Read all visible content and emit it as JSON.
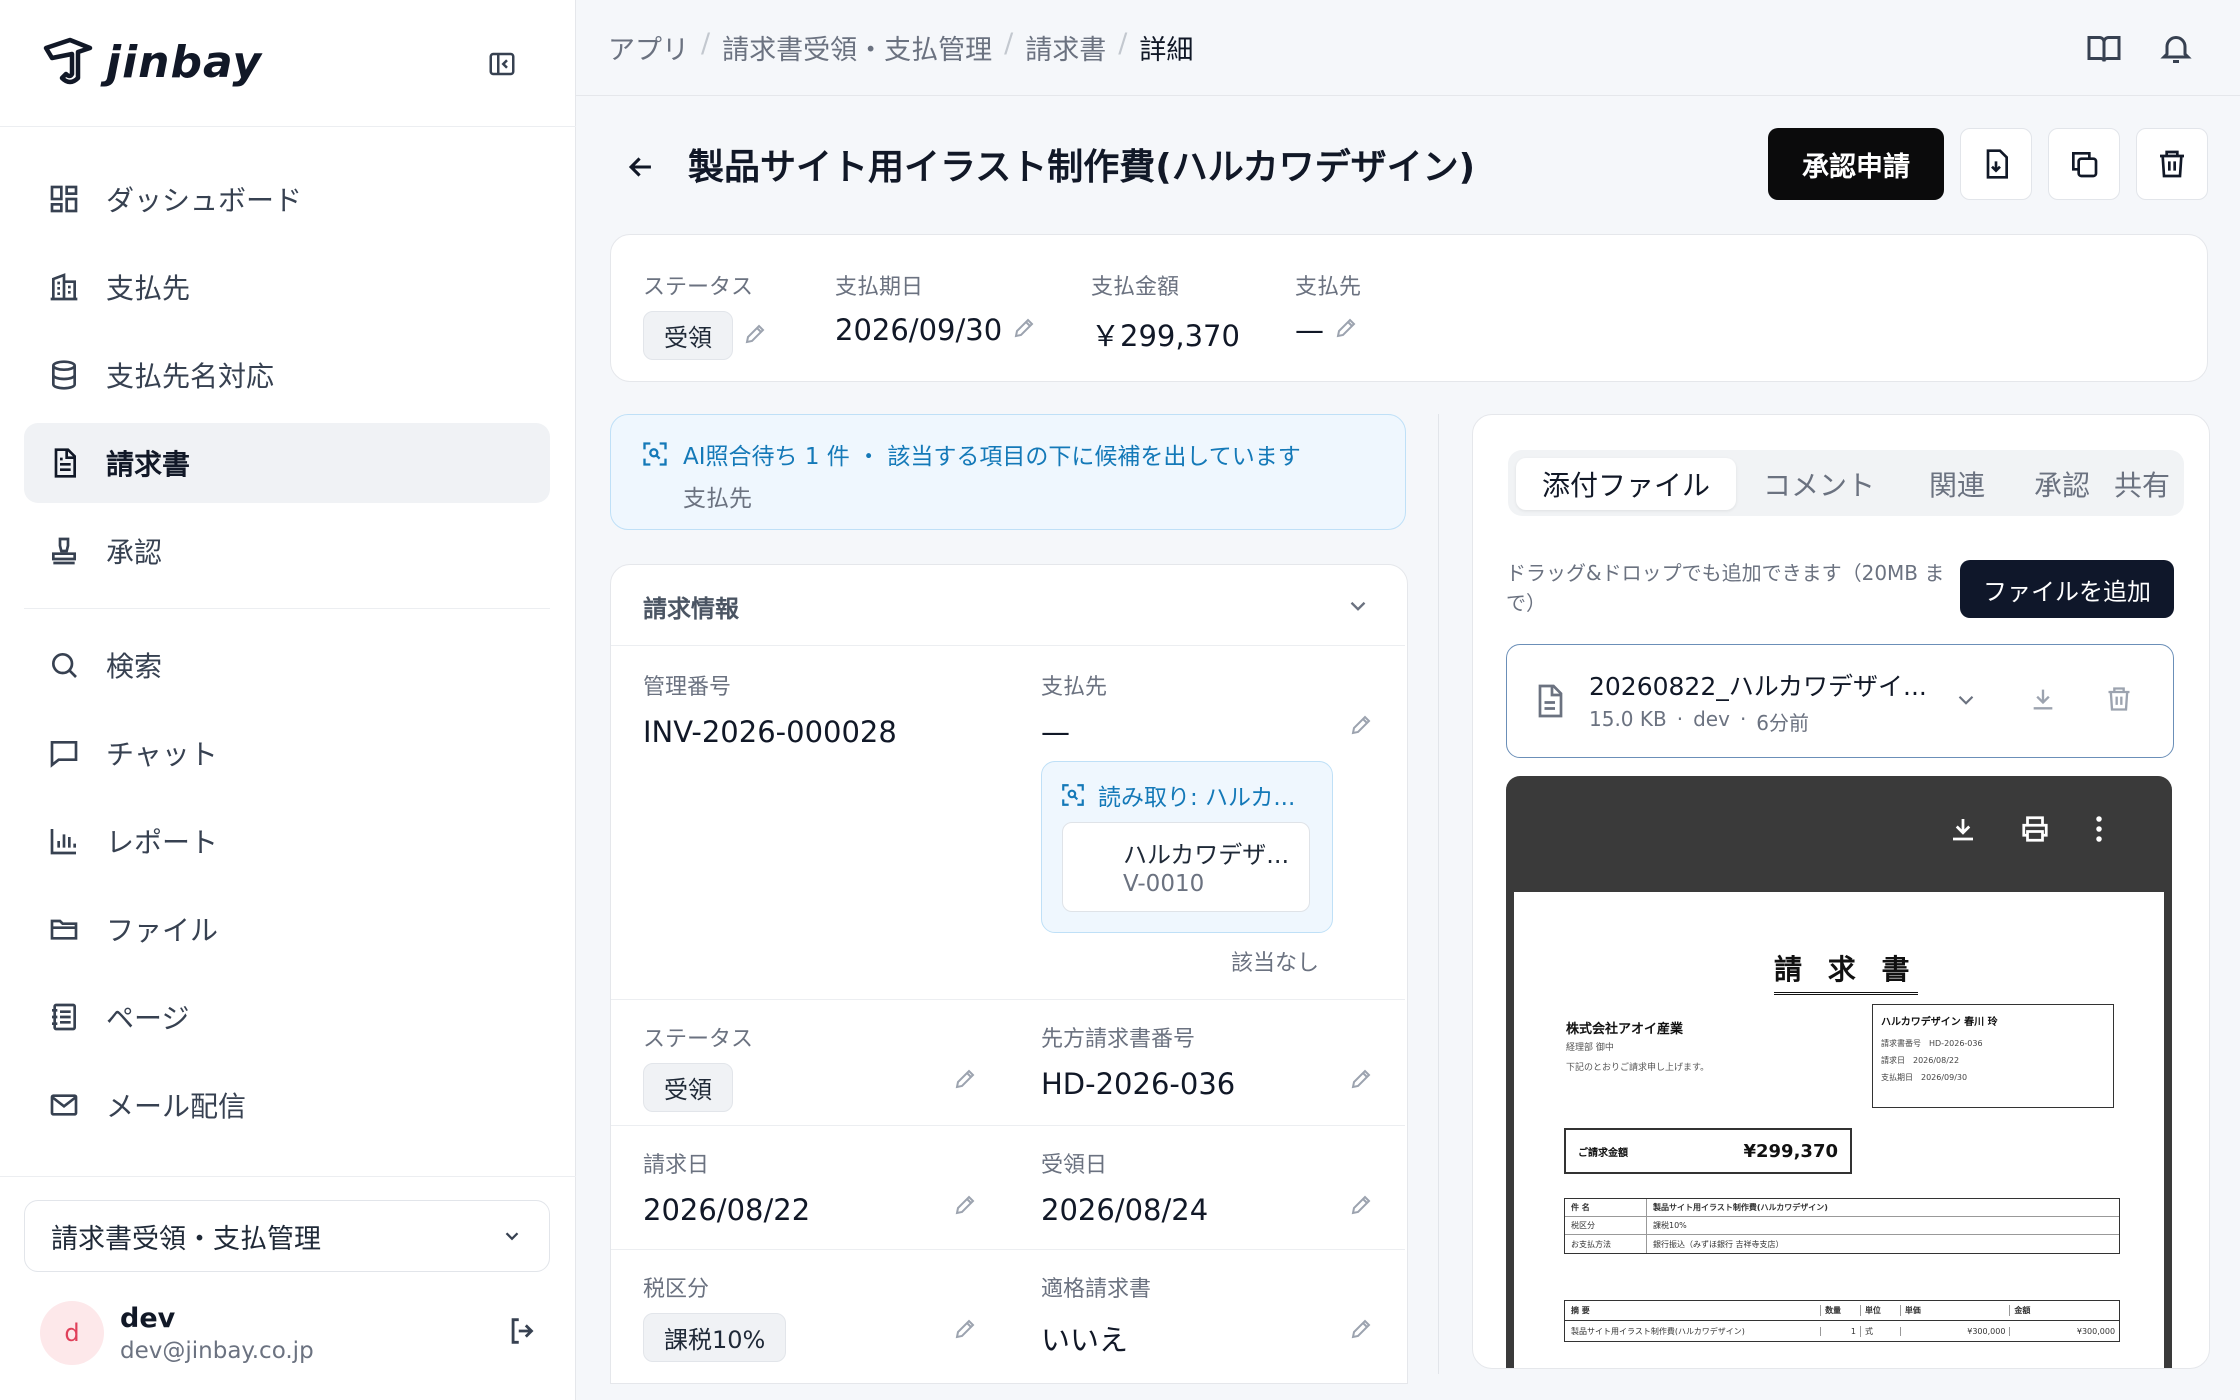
{
  "brand": {
    "name": "jinbay"
  },
  "sidebar": {
    "items": [
      {
        "label": "ダッシュボード",
        "icon": "dashboard-icon"
      },
      {
        "label": "支払先",
        "icon": "building-icon"
      },
      {
        "label": "支払先名対応",
        "icon": "database-icon"
      },
      {
        "label": "請求書",
        "icon": "document-icon",
        "active": true
      },
      {
        "label": "承認",
        "icon": "stamp-icon"
      },
      {
        "label": "検索",
        "icon": "search-icon"
      },
      {
        "label": "チャット",
        "icon": "chat-icon"
      },
      {
        "label": "レポート",
        "icon": "chart-icon"
      },
      {
        "label": "ファイル",
        "icon": "folder-icon"
      },
      {
        "label": "ページ",
        "icon": "page-icon"
      },
      {
        "label": "メール配信",
        "icon": "mail-icon"
      }
    ],
    "workspace": "請求書受領・支払管理",
    "user": {
      "initial": "d",
      "name": "dev",
      "email": "dev@jinbay.co.jp"
    }
  },
  "breadcrumb": [
    "アプリ",
    "請求書受領・支払管理",
    "請求書",
    "詳細"
  ],
  "header": {
    "title": "製品サイト用イラスト制作費(ハルカワデザイン)",
    "submit_label": "承認申請"
  },
  "summary": {
    "status_label": "ステータス",
    "status_value": "受領",
    "due_label": "支払期日",
    "due_value": "2026/09/30",
    "amount_label": "支払金額",
    "amount_value": "￥299,370",
    "payee_label": "支払先",
    "payee_value": "—"
  },
  "ai_banner": {
    "text": "AI照合待ち 1 件 ・ 該当する項目の下に候補を出しています",
    "sub": "支払先"
  },
  "invoice_info": {
    "section_title": "請求情報",
    "mgmt_label": "管理番号",
    "mgmt_value": "INV-2026-000028",
    "payee_label": "支払先",
    "payee_value": "—",
    "ocr_label": "読み取り: ハルカ...",
    "candidate_name": "ハルカワデザ...",
    "candidate_code": "V-0010",
    "no_match": "該当なし",
    "status_label": "ステータス",
    "status_value": "受領",
    "vendor_no_label": "先方請求書番号",
    "vendor_no_value": "HD-2026-036",
    "invoice_date_label": "請求日",
    "invoice_date_value": "2026/08/22",
    "received_date_label": "受領日",
    "received_date_value": "2026/08/24",
    "tax_label": "税区分",
    "tax_value": "課税10%",
    "qualified_label": "適格請求書",
    "qualified_value": "いいえ"
  },
  "attachments": {
    "tabs": [
      "添付ファイル",
      "コメント",
      "関連",
      "承認",
      "共有"
    ],
    "hint": "ドラッグ&ドロップでも追加できます（20MB まで）",
    "add_label": "ファイルを追加",
    "file": {
      "name": "20260822_ハルカワデザイ...",
      "size": "15.0 KB",
      "uploader": "dev",
      "time": "6分前"
    }
  },
  "preview": {
    "doc_title": "請 求 書",
    "to_company": "株式会社アオイ産業",
    "to_dept": "経理部 御中",
    "greeting": "下記のとおりご請求申し上げます。",
    "from_company": "ハルカワデザイン 春川 玲",
    "meta": [
      [
        "請求書番号",
        "HD-2026-036"
      ],
      [
        "請求日",
        "2026/08/22"
      ],
      [
        "支払期日",
        "2026/09/30"
      ]
    ],
    "total_label": "ご請求金額",
    "total_value": "¥299,370",
    "info_rows": [
      [
        "件 名",
        "製品サイト用イラスト制作費(ハルカワデザイン)"
      ],
      [
        "税区分",
        "課税10%"
      ],
      [
        "お支払方法",
        "銀行振込（みずほ銀行 吉祥寺支店）"
      ]
    ],
    "item_headers": [
      "摘 要",
      "数量",
      "単位",
      "単価",
      "金額"
    ],
    "item_row": [
      "製品サイト用イラスト制作費(ハルカワデザイン)",
      "1",
      "式",
      "¥300,000",
      "¥300,000"
    ]
  }
}
